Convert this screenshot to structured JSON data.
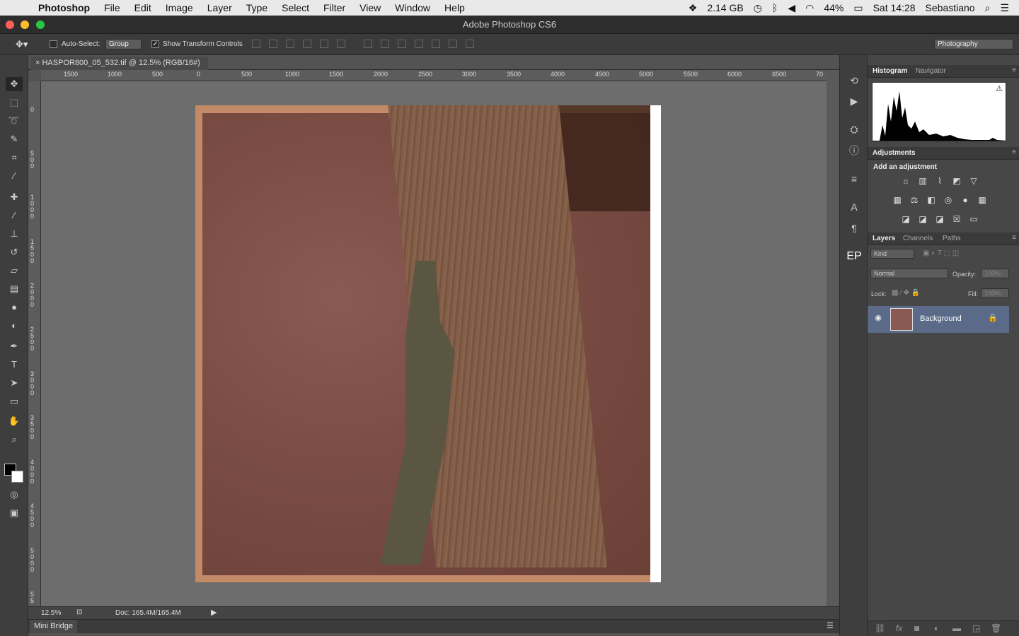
{
  "menubar": {
    "app": "Photoshop",
    "items": [
      "File",
      "Edit",
      "Image",
      "Layer",
      "Type",
      "Select",
      "Filter",
      "View",
      "Window",
      "Help"
    ],
    "status": {
      "storage": "2.14 GB",
      "battery": "44%",
      "clock": "Sat 14:28",
      "user": "Sebastiano"
    }
  },
  "window": {
    "title": "Adobe Photoshop CS6"
  },
  "options": {
    "auto_select_label": "Auto-Select:",
    "auto_select_value": "Group",
    "show_transform_label": "Show Transform Controls",
    "workspace": "Photography"
  },
  "document": {
    "tab_title": "HASPOR800_05_532.tif @ 12.5% (RGB/16#)",
    "zoom": "12.5%",
    "doc_size": "Doc: 165.4M/165.4M"
  },
  "ruler": {
    "h_ticks": [
      "1500",
      "1000",
      "500",
      "0",
      "500",
      "1000",
      "1500",
      "2000",
      "2500",
      "3000",
      "3500",
      "4000",
      "4500",
      "5000",
      "5500",
      "6000",
      "6500",
      "70"
    ],
    "v_ticks": [
      "0",
      "5\n0\n0",
      "1\n0\n0\n0",
      "1\n5\n0\n0",
      "2\n0\n0\n0",
      "2\n5\n0\n0",
      "3\n0\n0\n0",
      "3\n5\n0\n0",
      "4\n0\n0\n0",
      "4\n5\n0\n0",
      "5\n0\n0\n0",
      "5\n5"
    ]
  },
  "bottom": {
    "mini_bridge": "Mini Bridge"
  },
  "panels": {
    "histogram_tabs": [
      "Histogram",
      "Navigator"
    ],
    "adjustments": {
      "title": "Adjustments",
      "hint": "Add an adjustment"
    },
    "layer_tabs": [
      "Layers",
      "Channels",
      "Paths"
    ],
    "filter_kind": "Kind",
    "blend_mode": "Normal",
    "opacity_label": "Opacity:",
    "opacity_value": "100%",
    "lock_label": "Lock:",
    "fill_label": "Fill:",
    "fill_value": "100%",
    "layers": [
      {
        "name": "Background",
        "locked": true,
        "visible": true
      }
    ]
  },
  "colors": {
    "accent": "#5a6a88",
    "chrome": "#535353",
    "panel": "#474747"
  }
}
